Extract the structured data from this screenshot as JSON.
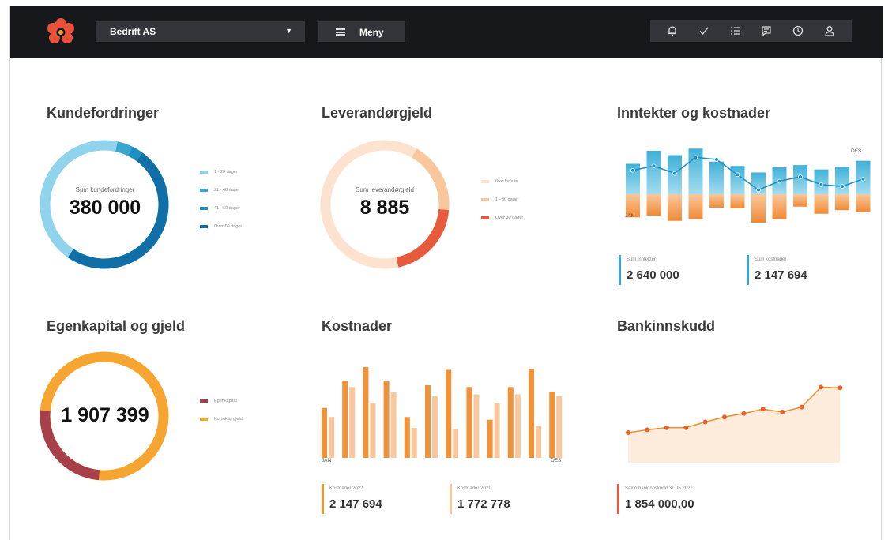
{
  "header": {
    "company": "Bedrift AS",
    "menu_label": "Meny",
    "icons": [
      "bell-icon",
      "check-icon",
      "list-icon",
      "message-icon",
      "clock-icon",
      "user-icon"
    ]
  },
  "colors": {
    "topbar": "#17181c",
    "blue_dark": "#0f6fa6",
    "blue_mid": "#3aa6d0",
    "blue_light": "#8fd3ec",
    "orange": "#f0923a",
    "orange_light": "#f9c79b",
    "red": "#e85a3c",
    "maroon": "#a8404a",
    "amber": "#f6a531",
    "peach_fill": "#fdebdc"
  },
  "kundefordringer": {
    "title": "Kundefordringer",
    "center_label": "Sum kundefordringer",
    "center_value": "380 000",
    "legend": [
      "1 - 20 dager",
      "21 - 40 dager",
      "41 - 60 dager",
      "Over 60 dager"
    ]
  },
  "leverandorgjeld": {
    "title": "Leverandørgjeld",
    "center_label": "Sum leverandørgjeld",
    "center_value": "8 885",
    "legend": [
      "Ikke forfalte",
      "1 - 30 dager",
      "Over 30 dager"
    ]
  },
  "inntekter": {
    "title": "Inntekter og kostnader",
    "label_jan": "JAN",
    "label_des": "DES",
    "stat1_label": "Sum inntekter",
    "stat1_value": "2 640 000",
    "stat2_label": "Sum kostnader",
    "stat2_value": "2 147 694",
    "income": [
      0.7,
      1.0,
      0.9,
      1.05,
      0.75,
      0.65,
      0.5,
      0.62,
      0.67,
      0.57,
      0.63,
      0.77
    ],
    "costs": [
      0.65,
      0.6,
      0.75,
      0.7,
      0.38,
      0.4,
      0.8,
      0.7,
      0.35,
      0.55,
      0.45,
      0.5
    ],
    "net": [
      0.55,
      0.65,
      0.48,
      0.85,
      0.8,
      0.45,
      0.1,
      0.3,
      0.4,
      0.22,
      0.18,
      0.35
    ]
  },
  "egenkapital": {
    "title": "Egenkapital og gjeld",
    "center_value": "1 907 399",
    "legend": [
      "Egenkapital",
      "Kortsiktig gjeld"
    ]
  },
  "kostnader": {
    "title": "Kostnader",
    "label_jan": "JAN",
    "label_des": "DES",
    "stat1_label": "Kostnader 2022",
    "stat1_value": "2 147 694",
    "stat2_label": "Kostnader 2021",
    "stat2_value": "1 772 778",
    "y2022": [
      0.55,
      0.85,
      1.0,
      0.85,
      0.45,
      0.8,
      0.97,
      0.78,
      0.42,
      0.78,
      0.98,
      0.73
    ],
    "y2021": [
      0.45,
      0.78,
      0.6,
      0.72,
      0.33,
      0.68,
      0.32,
      0.7,
      0.6,
      0.7,
      0.35,
      0.68
    ]
  },
  "bankinnskudd": {
    "title": "Bankinnskudd",
    "stat_label": "Saldo bankinnskudd 31.05.2022",
    "stat_value": "1 854 000,00",
    "series": [
      0.2,
      0.24,
      0.27,
      0.27,
      0.35,
      0.42,
      0.47,
      0.53,
      0.49,
      0.56,
      0.84,
      0.83
    ]
  }
}
